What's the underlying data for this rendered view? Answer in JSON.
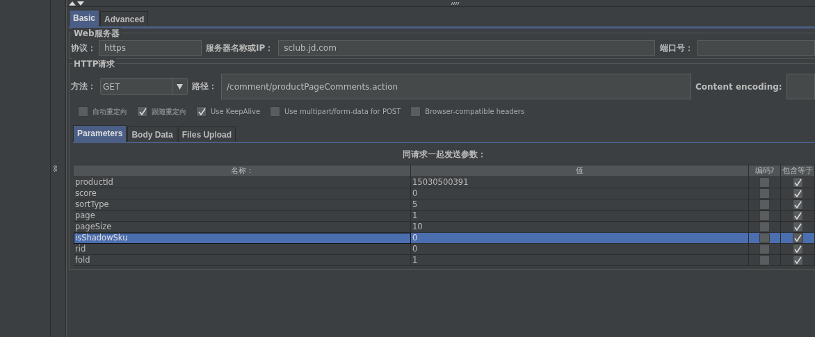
{
  "tabs": [
    {
      "label": "Basic",
      "selected": true
    },
    {
      "label": "Advanced",
      "selected": false
    }
  ],
  "web_server": {
    "title": "Web服务器",
    "protocol_label": "协议：",
    "protocol": "https",
    "server_label": "服务器名称或IP：",
    "server": "sclub.jd.com",
    "port_label": "端口号："
  },
  "http_request": {
    "title": "HTTP请求",
    "method_label": "方法：",
    "method": "GET",
    "path_label": "路径：",
    "path": "/comment/productPageComments.action",
    "encoding_label": "Content encoding:",
    "options": [
      {
        "label": "自动重定向",
        "checked": false
      },
      {
        "label": "跟随重定向",
        "checked": true
      },
      {
        "label": "Use KeepAlive",
        "checked": true
      },
      {
        "label": "Use multipart/form-data for POST",
        "checked": false
      },
      {
        "label": "Browser-compatible headers",
        "checked": false
      }
    ]
  },
  "sub_tabs": [
    {
      "label": "Parameters",
      "selected": true
    },
    {
      "label": "Body Data",
      "selected": false
    },
    {
      "label": "Files Upload",
      "selected": false
    }
  ],
  "parameters": {
    "title": "同请求一起发送参数：",
    "columns": [
      "名称：",
      "值",
      "编码?",
      "包含等于"
    ],
    "rows": [
      {
        "name": "productId",
        "value": "15030500391",
        "encode": false,
        "include_equals": true,
        "selected": false
      },
      {
        "name": "score",
        "value": "0",
        "encode": false,
        "include_equals": true,
        "selected": false
      },
      {
        "name": "sortType",
        "value": "5",
        "encode": false,
        "include_equals": true,
        "selected": false
      },
      {
        "name": "page",
        "value": "1",
        "encode": false,
        "include_equals": true,
        "selected": false
      },
      {
        "name": "pageSize",
        "value": "10",
        "encode": false,
        "include_equals": true,
        "selected": false
      },
      {
        "name": "isShadowSku",
        "value": "0",
        "encode": false,
        "include_equals": true,
        "selected": true
      },
      {
        "name": "rid",
        "value": "0",
        "encode": false,
        "include_equals": true,
        "selected": false
      },
      {
        "name": "fold",
        "value": "1",
        "encode": false,
        "include_equals": true,
        "selected": false
      }
    ]
  }
}
